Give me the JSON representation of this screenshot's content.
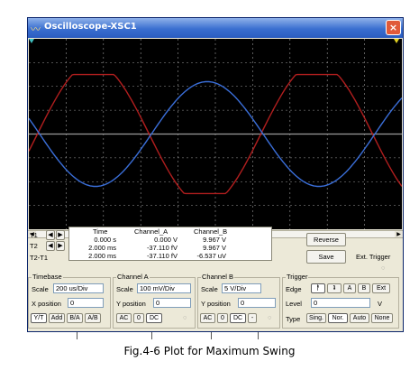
{
  "window": {
    "title": "Oscilloscope-XSC1",
    "close_glyph": "×"
  },
  "scope_display": {
    "background": "#000000",
    "grid_color": "#9a9a9a",
    "channel_a_color": "#b01e1e",
    "channel_b_color": "#3a6ed8",
    "channel_a_level": "clipped at about ±2.5 divisions",
    "channel_b_level": "about ±2.2 divisions"
  },
  "measure": {
    "headers": [
      "Time",
      "Channel_A",
      "Channel_B"
    ],
    "rows": [
      {
        "label": "T1",
        "time": "0.000 s",
        "a": "0.000 V",
        "b": "9.967 V"
      },
      {
        "label": "T2",
        "time": "2.000 ms",
        "a": "-37.110 fV",
        "b": "9.967 V"
      },
      {
        "label": "T2-T1",
        "time": "2.000 ms",
        "a": "-37.110 fV",
        "b": "-6.537 uV"
      }
    ]
  },
  "buttons": {
    "reverse": "Reverse",
    "save": "Save",
    "ext_trigger": "Ext. Trigger"
  },
  "timebase": {
    "title": "Timebase",
    "scale_label": "Scale",
    "scale_value": "200 us/Div",
    "xpos_label": "X position",
    "xpos_value": "0",
    "modes": [
      "Y/T",
      "Add",
      "B/A",
      "A/B"
    ]
  },
  "channel_a": {
    "title": "Channel A",
    "scale_label": "Scale",
    "scale_value": "100 mV/Div",
    "ypos_label": "Y position",
    "ypos_value": "0",
    "coupling": [
      "AC",
      "0",
      "DC"
    ]
  },
  "channel_b": {
    "title": "Channel B",
    "scale_label": "Scale",
    "scale_value": "5 V/Div",
    "ypos_label": "Y position",
    "ypos_value": "0",
    "coupling": [
      "AC",
      "0",
      "DC",
      "-"
    ]
  },
  "trigger": {
    "title": "Trigger",
    "edge_label": "Edge",
    "edge_buttons": [
      "A",
      "B",
      "Ext"
    ],
    "level_label": "Level",
    "level_value": "0",
    "level_unit": "V",
    "type_label": "Type",
    "types": [
      "Sing.",
      "Nor.",
      "Auto",
      "None"
    ]
  },
  "caption": "Fig.4-6 Plot for Maximum Swing"
}
